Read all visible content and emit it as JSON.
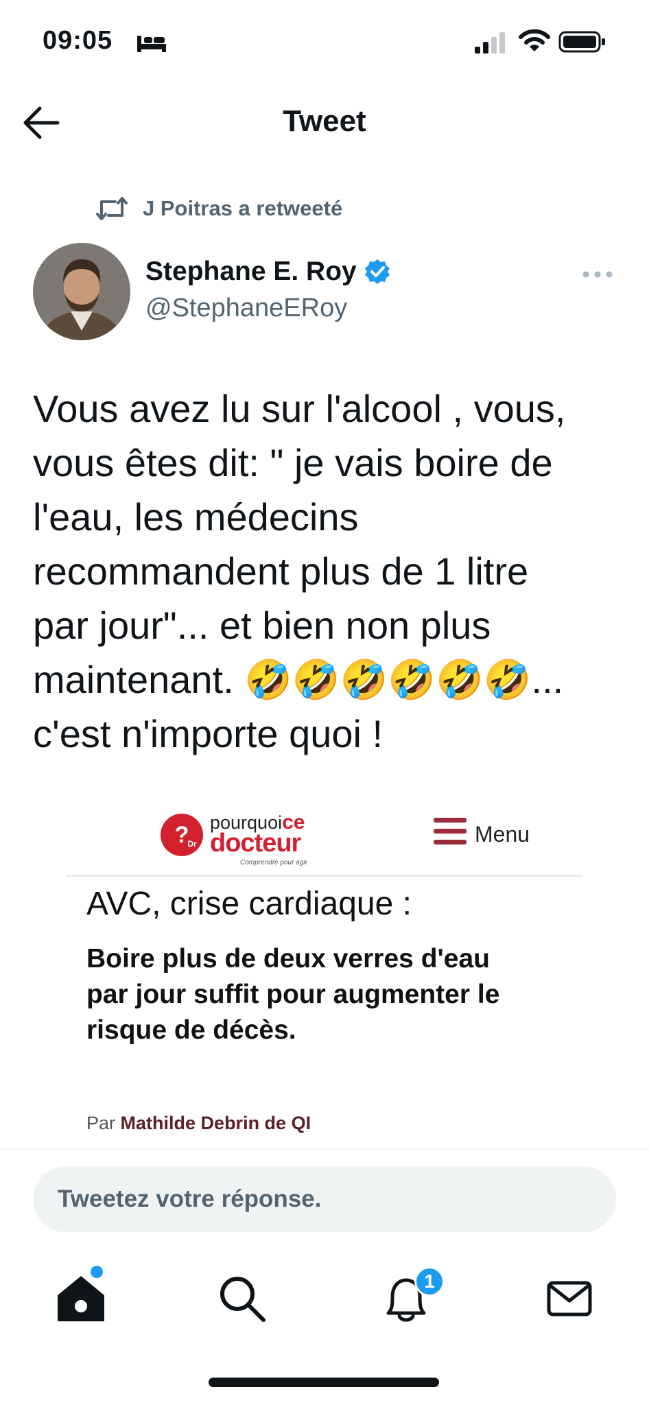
{
  "status_bar": {
    "time": "09:05",
    "icons": [
      "bed-icon",
      "signal-icon",
      "wifi-icon",
      "battery-icon"
    ]
  },
  "nav": {
    "title": "Tweet",
    "back_icon": "back-arrow-icon"
  },
  "retweet": {
    "text": "J Poitras a retweeté",
    "icon": "retweet-icon"
  },
  "author": {
    "name": "Stephane E. Roy",
    "handle": "@StephaneERoy",
    "verified": true
  },
  "tweet": {
    "lines": [
      "Vous avez lu sur l'alcool , vous,",
      "vous êtes dit: \" je vais boire de",
      "l'eau, les médecins",
      "recommandent plus de 1 litre",
      "par jour\"... et bien non plus",
      "maintenant. 🤣🤣🤣🤣🤣🤣...",
      "c'est n'importe quoi !"
    ]
  },
  "media": {
    "logo_top_1": "pourquoi",
    "logo_top_2": "ce",
    "logo_bottom": "docteur",
    "logo_tagline": "Comprendre pour agir",
    "menu_label": "Menu",
    "headline": "AVC, crise cardiaque :",
    "subheadline": "Boire plus de deux verres d'eau par jour suffit pour augmenter le risque de décès.",
    "byline_prefix": "Par",
    "byline_author": "Mathilde Debrin de QI"
  },
  "reply": {
    "placeholder": "Tweetez votre réponse."
  },
  "tabs": [
    {
      "name": "home",
      "icon": "home-icon"
    },
    {
      "name": "search",
      "icon": "search-icon"
    },
    {
      "name": "notifications",
      "icon": "bell-icon",
      "badge": "1"
    },
    {
      "name": "messages",
      "icon": "mail-icon"
    }
  ],
  "colors": {
    "accent": "#1d9bf0",
    "text": "#0f1419",
    "secondary": "#536471",
    "brand_red": "#d2202f"
  }
}
